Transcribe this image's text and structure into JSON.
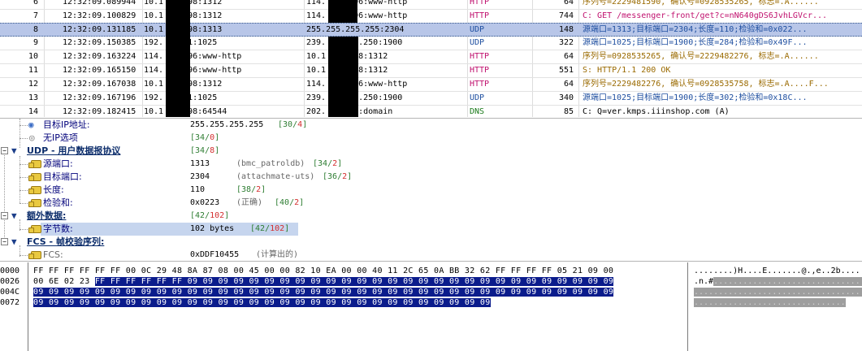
{
  "packets": [
    {
      "no": "6",
      "time": "12:32:09.089944",
      "src": "10.1",
      "src_tail": "98:1312",
      "dst": "114.",
      "dst_tail": "96:www-http",
      "proto": "HTTP",
      "len": "64",
      "info": "序列号=2229481590, 确认号=0928535265, 标志=.A......"
    },
    {
      "no": "7",
      "time": "12:32:09.100829",
      "src": "10.1",
      "src_tail": "98:1312",
      "dst": "114.",
      "dst_tail": "96:www-http",
      "proto": "HTTP",
      "len": "744",
      "info": "C: GET /messenger-front/get?c=nN640gDS6JvhLGVcr..."
    },
    {
      "no": "8",
      "time": "12:32:09.131185",
      "src": "10.1",
      "src_tail": "98:1313",
      "dst": "255.255.255.255:2304",
      "dst_tail": "",
      "proto": "UDP",
      "len": "148",
      "info": "源端口=1313;目标端口=2304;长度=110;检验和=0x022..."
    },
    {
      "no": "9",
      "time": "12:32:09.150385",
      "src": "192.",
      "src_tail": "1:1025",
      "dst": "239.",
      "dst_tail": "5.250:1900",
      "proto": "UDP",
      "len": "322",
      "info": "源端口=1025;目标端口=1900;长度=284;检验和=0x49F..."
    },
    {
      "no": "10",
      "time": "12:32:09.163224",
      "src": "114.",
      "src_tail": "96:www-http",
      "dst": "10.1",
      "dst_tail": "98:1312",
      "proto": "HTTP",
      "len": "64",
      "info": "序列号=0928535265, 确认号=2229482276, 标志=.A......"
    },
    {
      "no": "11",
      "time": "12:32:09.165150",
      "src": "114.",
      "src_tail": "96:www-http",
      "dst": "10.1",
      "dst_tail": "98:1312",
      "proto": "HTTP",
      "len": "551",
      "info": "S: HTTP/1.1 200 OK"
    },
    {
      "no": "12",
      "time": "12:32:09.167038",
      "src": "10.1",
      "src_tail": "98:1312",
      "dst": "114.",
      "dst_tail": "96:www-http",
      "proto": "HTTP",
      "len": "64",
      "info": "序列号=2229482276, 确认号=0928535758, 标志=.A....F..."
    },
    {
      "no": "13",
      "time": "12:32:09.167196",
      "src": "192.",
      "src_tail": "1:1025",
      "dst": "239.",
      "dst_tail": "5.250:1900",
      "proto": "UDP",
      "len": "340",
      "info": "源端口=1025;目标端口=1900;长度=302;检验和=0x18C..."
    },
    {
      "no": "14",
      "time": "12:32:09.182415",
      "src": "10.1",
      "src_tail": "98:64544",
      "dst": "202.",
      "dst_tail": "2:domain",
      "proto": "DNS",
      "len": "85",
      "info": "C: Q=ver.kmps.iiinshop.com (A)"
    }
  ],
  "colors": {
    "HTTP": "#c0116e",
    "UDP": "#1f4fa0",
    "DNS": "#1b7a1b",
    "info_http": "#9a6a00",
    "info_udp": "#1f4fa0",
    "info_get": "#c0116e"
  },
  "details": {
    "dst_ip_label": "目标IP地址:",
    "dst_ip_value": "255.255.255.255",
    "dst_ip_off": "30",
    "dst_ip_len": "4",
    "no_ip_opt_label": "无IP选项",
    "no_ip_opt_off": "34",
    "no_ip_opt_len": "0",
    "udp_label": "UDP - 用户数据报协议",
    "udp_off": "34",
    "udp_len": "8",
    "src_port_label": "源端口:",
    "src_port_value": "1313",
    "src_port_note": "(bmc_patroldb)",
    "src_port_off": "34",
    "src_port_len": "2",
    "dst_port_label": "目标端口:",
    "dst_port_value": "2304",
    "dst_port_note": "(attachmate-uts)",
    "dst_port_off": "36",
    "dst_port_len": "2",
    "length_label": "长度:",
    "length_value": "110",
    "length_off": "38",
    "length_len": "2",
    "checksum_label": "检验和:",
    "checksum_value": "0x0223",
    "checksum_note": "(正确)",
    "checksum_off": "40",
    "checksum_len": "2",
    "extra_label": "额外数据:",
    "extra_off": "42",
    "extra_len": "102",
    "bytes_label": "字节数:",
    "bytes_value": "102 bytes",
    "bytes_off": "42",
    "bytes_len": "102",
    "fcs_label": "FCS - 帧校验序列:",
    "fcs_field_label": "FCS:",
    "fcs_value": "0xDDF10455",
    "fcs_note": "(计算出的)"
  },
  "hex": {
    "rows": [
      {
        "offset": "0000",
        "plain": "FF FF FF FF FF FF 00 0C 29 48 8A 87 08 00 45 00 00 82 10 EA 00 00 40 11 2C 65 0A BB 32 62 FF FF FF FF 05 21 09 00",
        "sel": "",
        "ascii_plain": "........)H....E.......@.,e..2b.....!..",
        "ascii_sel": ""
      },
      {
        "offset": "0026",
        "plain": "00 6E 02 23 ",
        "sel": "FF FF FF FF FF FF 09 09 09 09 09 09 09 09 09 09 09 09 09 09 09 09 09 09 09 09 09 09 09 09 09 09 09 09",
        "ascii_plain": ".n.#",
        "ascii_sel": "..................................."
      },
      {
        "offset": "004C",
        "plain": "",
        "sel": "09 09 09 09 09 09 09 09 09 09 09 09 09 09 09 09 09 09 09 09 09 09 09 09 09 09 09 09 09 09 09 09 09 09 09 09 09 09",
        "ascii_plain": "",
        "ascii_sel": "......................................"
      },
      {
        "offset": "0072",
        "plain": "",
        "sel": "09 09 09 09 09 09 09 09 09 09 09 09 09 09 09 09 09 09 09 09 09 09 09 09 09 09 09 09 09 09",
        "ascii_plain": "",
        "ascii_sel": "..............................."
      }
    ]
  }
}
